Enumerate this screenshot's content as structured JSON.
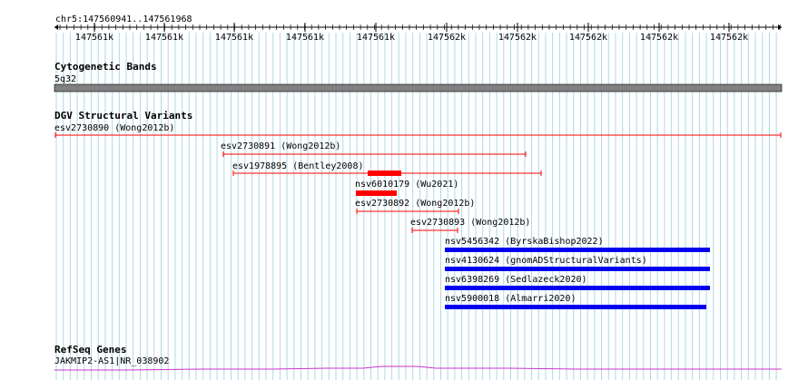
{
  "ruler": {
    "range_label": "chr5:147560941..147561968",
    "tick_labels": [
      "147561k",
      "147561k",
      "147561k",
      "147561k",
      "147561k",
      "147562k",
      "147562k",
      "147562k",
      "147562k",
      "147562k"
    ]
  },
  "tracks": {
    "cytoband": {
      "title": "Cytogenetic Bands",
      "band_label": "5q32",
      "band_color": "#808080"
    },
    "dgv": {
      "title": "DGV Structural Variants",
      "features": [
        {
          "label": "esv2730890 (Wong2012b)",
          "kind": "loss",
          "color": "#ff0000"
        },
        {
          "label": "esv2730891 (Wong2012b)",
          "kind": "loss",
          "color": "#ff0000"
        },
        {
          "label": "esv1978895 (Bentley2008)",
          "kind": "loss",
          "color": "#ff0000"
        },
        {
          "label": "nsv6010179 (Wu2021)",
          "kind": "loss-thick",
          "color": "#ff0000"
        },
        {
          "label": "esv2730892 (Wong2012b)",
          "kind": "loss",
          "color": "#ff0000"
        },
        {
          "label": "esv2730893 (Wong2012b)",
          "kind": "loss",
          "color": "#ff0000"
        },
        {
          "label": "nsv5456342 (ByrskaBishop2022)",
          "kind": "gain",
          "color": "#0000ee"
        },
        {
          "label": "nsv4130624 (gnomADStructuralVariants)",
          "kind": "gain",
          "color": "#0000ee"
        },
        {
          "label": "nsv6398269 (Sedlazeck2020)",
          "kind": "gain",
          "color": "#0000ee"
        },
        {
          "label": "nsv5900018 (Almarri2020)",
          "kind": "gain",
          "color": "#0000ee"
        }
      ]
    },
    "refseq": {
      "title": "RefSeq Genes",
      "gene_label": "JAKMIP2-AS1|NR_038902",
      "gene_color": "#cc33cc"
    }
  },
  "colors": {
    "grid": "#add8e6",
    "ruler": "#000000"
  }
}
